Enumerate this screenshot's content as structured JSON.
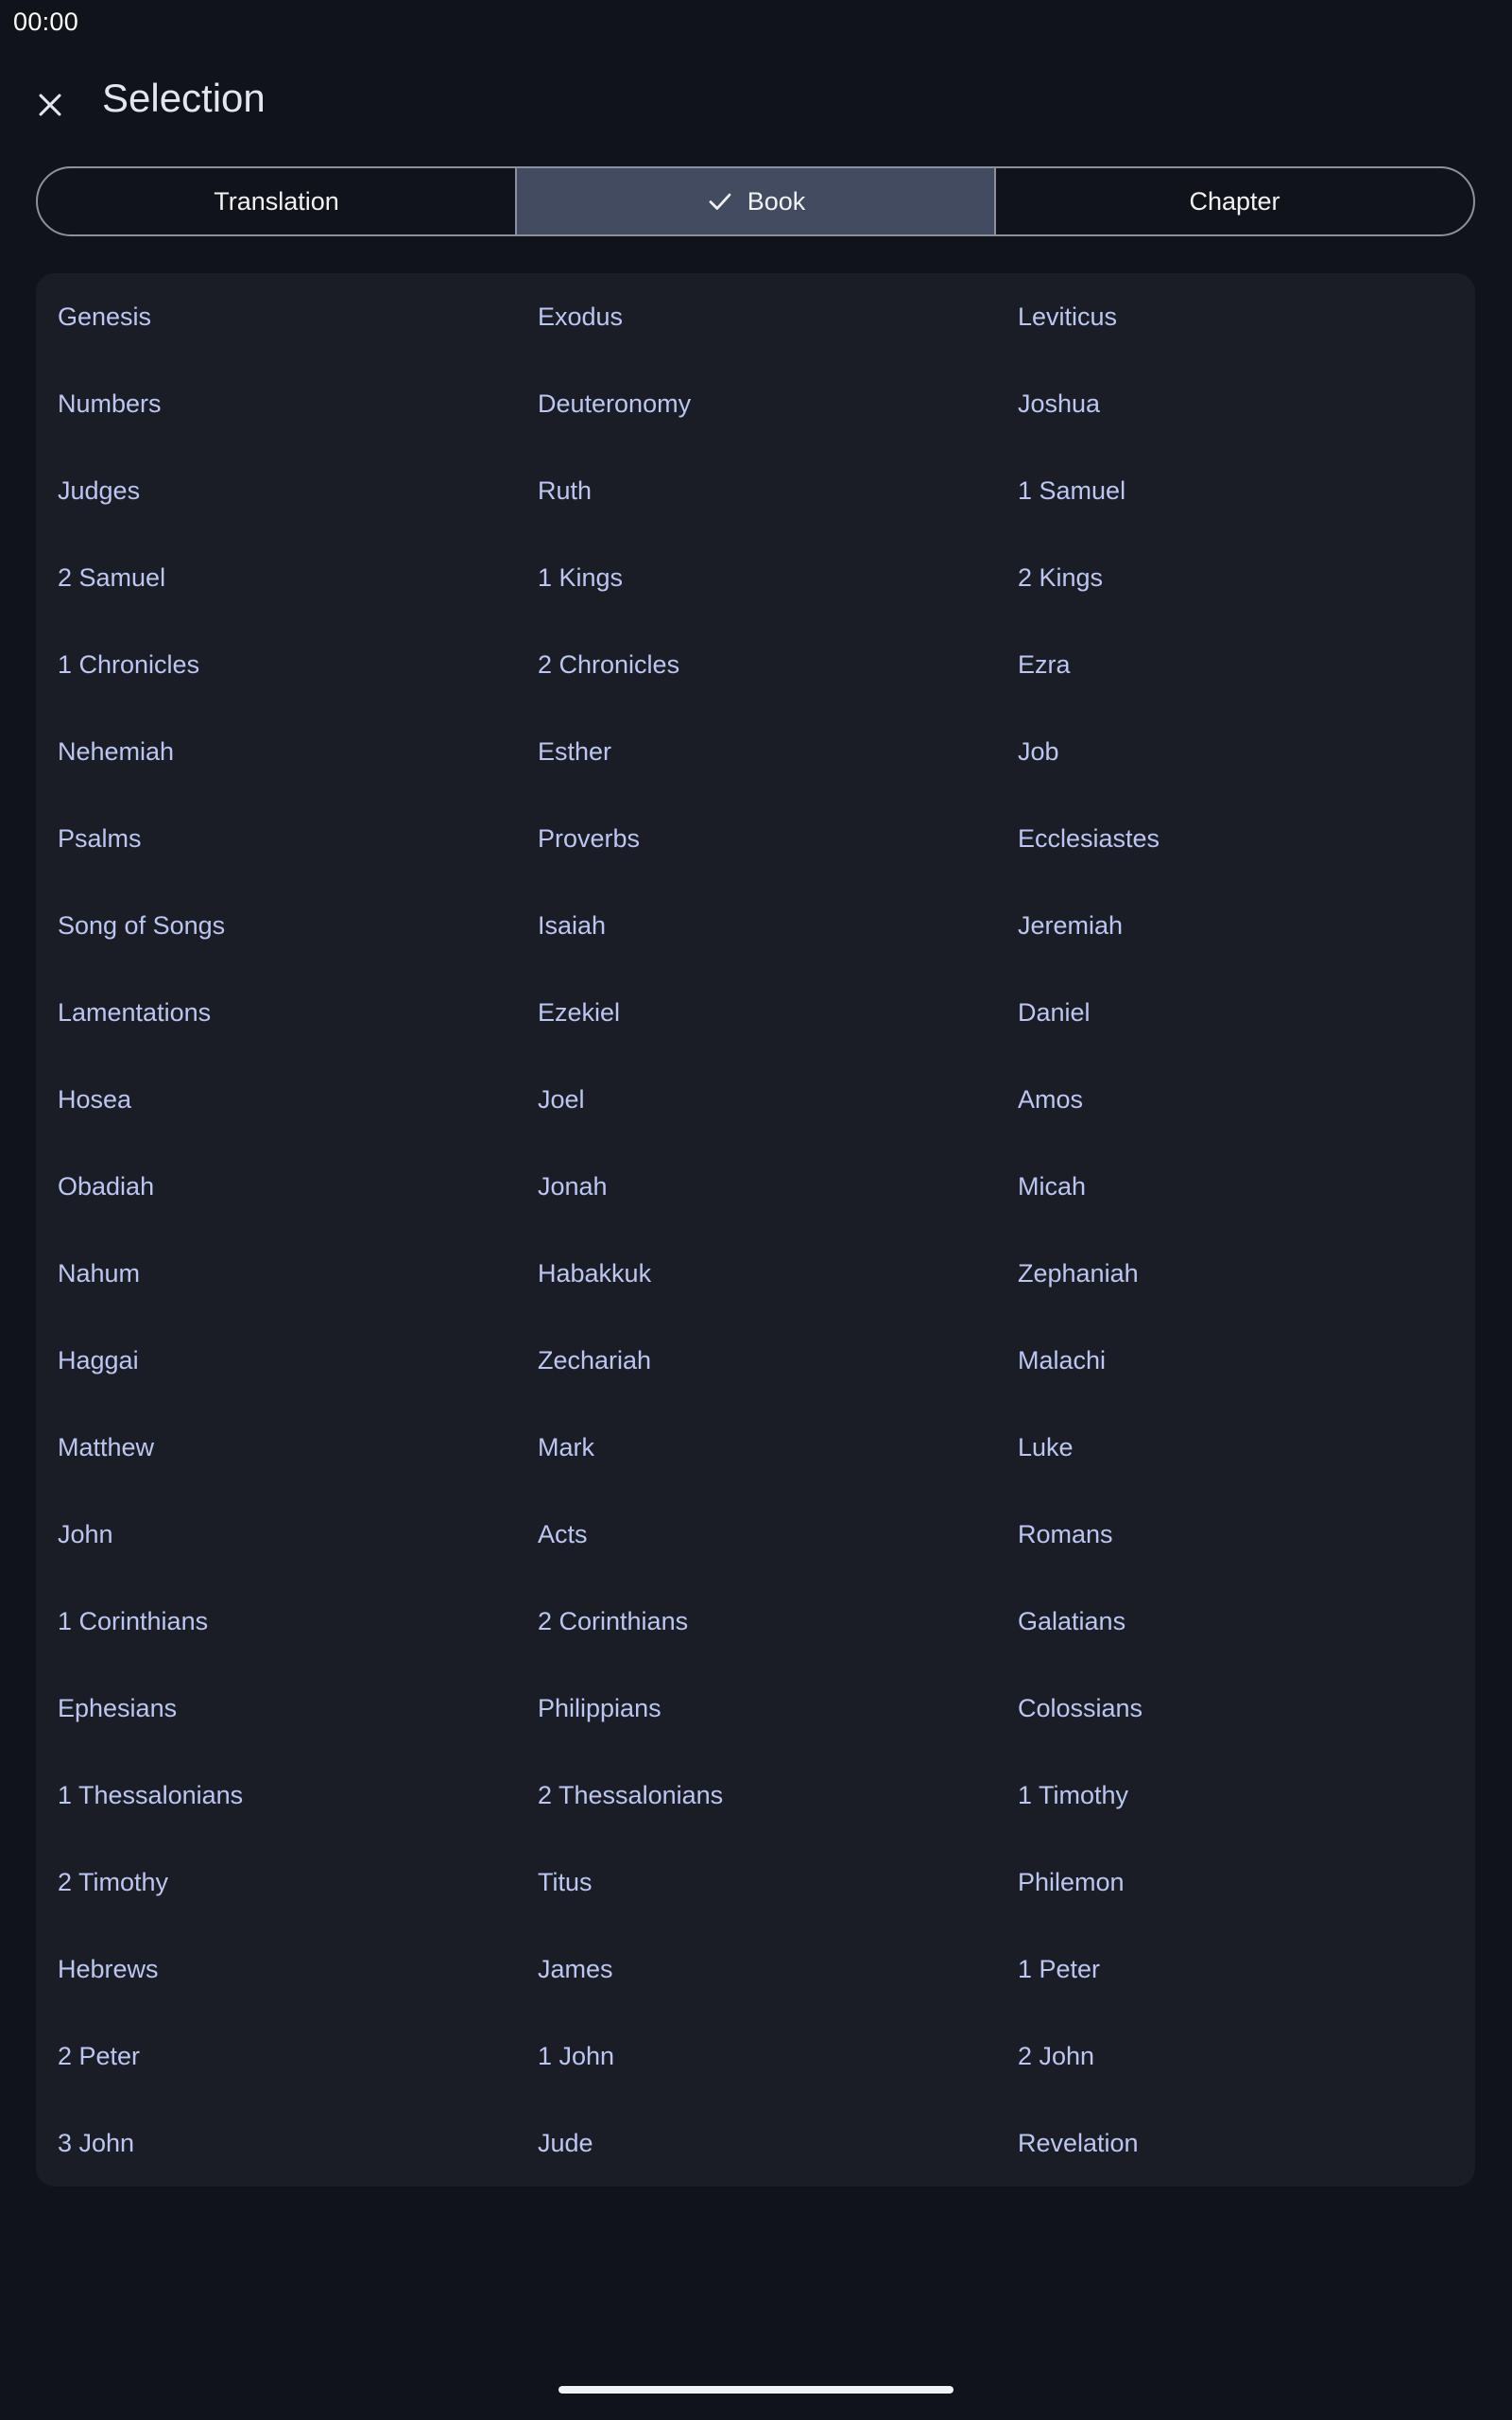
{
  "status_bar": {
    "time": "00:00"
  },
  "header": {
    "title": "Selection",
    "close_icon": "close-icon"
  },
  "tabs": [
    {
      "label": "Translation",
      "selected": false
    },
    {
      "label": "Book",
      "selected": true,
      "icon": "check-icon"
    },
    {
      "label": "Chapter",
      "selected": false
    }
  ],
  "books": [
    "Genesis",
    "Exodus",
    "Leviticus",
    "Numbers",
    "Deuteronomy",
    "Joshua",
    "Judges",
    "Ruth",
    "1 Samuel",
    "2 Samuel",
    "1 Kings",
    "2 Kings",
    "1 Chronicles",
    "2 Chronicles",
    "Ezra",
    "Nehemiah",
    "Esther",
    "Job",
    "Psalms",
    "Proverbs",
    "Ecclesiastes",
    "Song of Songs",
    "Isaiah",
    "Jeremiah",
    "Lamentations",
    "Ezekiel",
    "Daniel",
    "Hosea",
    "Joel",
    "Amos",
    "Obadiah",
    "Jonah",
    "Micah",
    "Nahum",
    "Habakkuk",
    "Zephaniah",
    "Haggai",
    "Zechariah",
    "Malachi",
    "Matthew",
    "Mark",
    "Luke",
    "John",
    "Acts",
    "Romans",
    "1 Corinthians",
    "2 Corinthians",
    "Galatians",
    "Ephesians",
    "Philippians",
    "Colossians",
    "1 Thessalonians",
    "2 Thessalonians",
    "1 Timothy",
    "2 Timothy",
    "Titus",
    "Philemon",
    "Hebrews",
    "James",
    "1 Peter",
    "2 Peter",
    "1 John",
    "2 John",
    "3 John",
    "Jude",
    "Revelation"
  ],
  "colors": {
    "background": "#11131a",
    "panel": "#1b1d26",
    "book_text": "#bcc6f0",
    "selected_tab": "#434b61",
    "outline": "#8d919e"
  }
}
